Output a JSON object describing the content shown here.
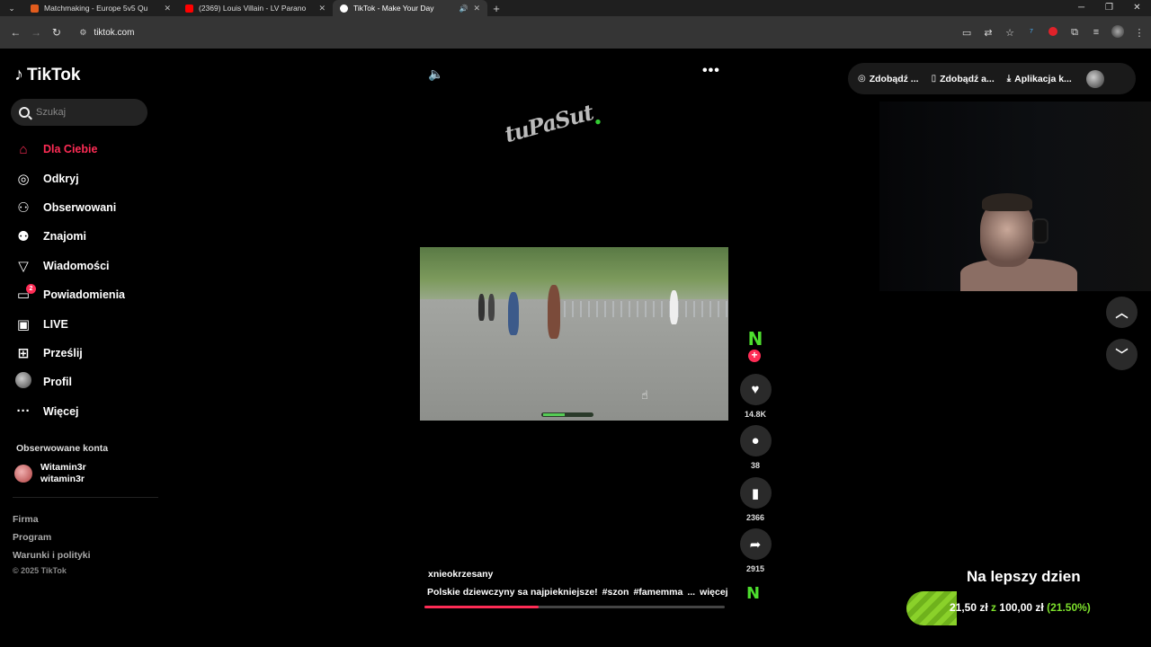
{
  "browser": {
    "tabs": [
      {
        "title": "Matchmaking - Europe 5v5 Qu",
        "favicon_color": "#e25c1d"
      },
      {
        "title": "(2369) Louis Villain - LV Parano",
        "favicon_color": "#ff0000"
      },
      {
        "title": "TikTok - Make Your Day",
        "favicon_color": "#ffffff"
      }
    ],
    "url": "tiktok.com"
  },
  "tiktok": {
    "logo": "TikTok",
    "search_placeholder": "Szukaj",
    "nav": [
      {
        "label": "Dla Ciebie",
        "icon": "home-icon"
      },
      {
        "label": "Odkryj",
        "icon": "compass-icon"
      },
      {
        "label": "Obserwowani",
        "icon": "following-icon"
      },
      {
        "label": "Znajomi",
        "icon": "friends-icon"
      },
      {
        "label": "Wiadomości",
        "icon": "send-icon"
      },
      {
        "label": "Powiadomienia",
        "icon": "inbox-icon",
        "badge": "2"
      },
      {
        "label": "LIVE",
        "icon": "live-tv-icon"
      },
      {
        "label": "Prześlij",
        "icon": "upload-icon"
      },
      {
        "label": "Profil",
        "icon": "profile-avatar"
      },
      {
        "label": "Więcej",
        "icon": "more-dots-icon"
      }
    ],
    "followed_header": "Obserwowane konta",
    "followed": {
      "display_name": "Witamin3r",
      "username": "witamin3r"
    },
    "footer": {
      "links": [
        "Firma",
        "Program",
        "Warunki i polityki"
      ],
      "copyright": "© 2025 TikTok"
    },
    "header_buttons": [
      "Zdobądź ...",
      "Zdobądź a...",
      "Aplikacja k..."
    ],
    "video": {
      "author": "xnieokrzesany",
      "description": "Polskie dziewczyny sa najpiekniejsze!",
      "hashtags": [
        "#szon",
        "#famemma"
      ],
      "more_label": "więcej",
      "watermark": "tuPaSut",
      "progress": 0.38
    },
    "actions": {
      "likes": "14.8K",
      "comments": "38",
      "saves": "2366",
      "shares": "2915"
    }
  },
  "overlay": {
    "goal_title": "Na lepszy dzien",
    "goal_current": "21,50 zł",
    "goal_of": "z",
    "goal_target": "100,00 zł",
    "goal_percent": "(21.50%)",
    "goal_fraction": 0.215
  },
  "colors": {
    "accent": "#fe2c55",
    "goal_green": "#7de02c",
    "background": "#000000"
  }
}
